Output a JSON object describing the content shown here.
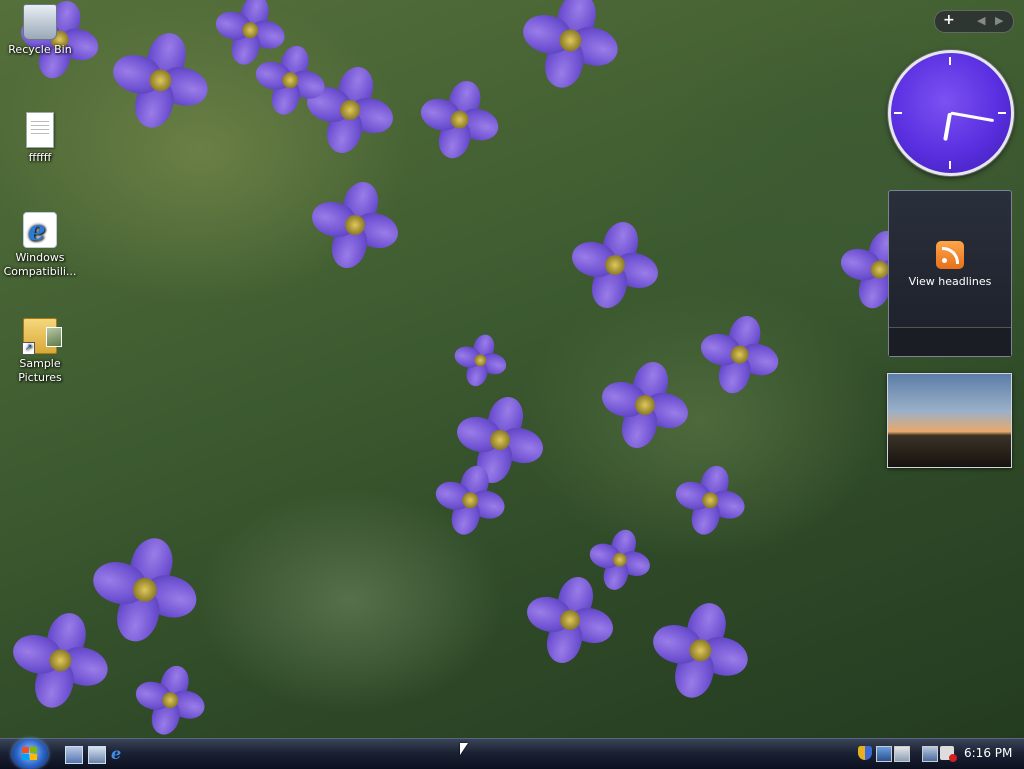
{
  "desktop": {
    "icons": [
      {
        "label": "Recycle Bin",
        "icon": "recycle-bin-icon"
      },
      {
        "label": "ffffff",
        "icon": "text-document-icon"
      },
      {
        "label": "Windows Compatibili...",
        "icon": "internet-explorer-icon"
      },
      {
        "label": "Sample Pictures",
        "icon": "pictures-folder-icon"
      }
    ]
  },
  "sidebar": {
    "controls": {
      "add": "+",
      "prev": "◀",
      "next": "▶"
    },
    "feed_label": "View headlines"
  },
  "taskbar": {
    "clock_time": "6:16 PM",
    "quick_launch": [
      "show-desktop-icon",
      "switch-windows-icon",
      "internet-explorer-icon"
    ],
    "ie_glyph": "e"
  },
  "colors": {
    "clock_face": "#5a2fe0",
    "taskbar": "#1b2233",
    "rss": "#f08a2a"
  }
}
